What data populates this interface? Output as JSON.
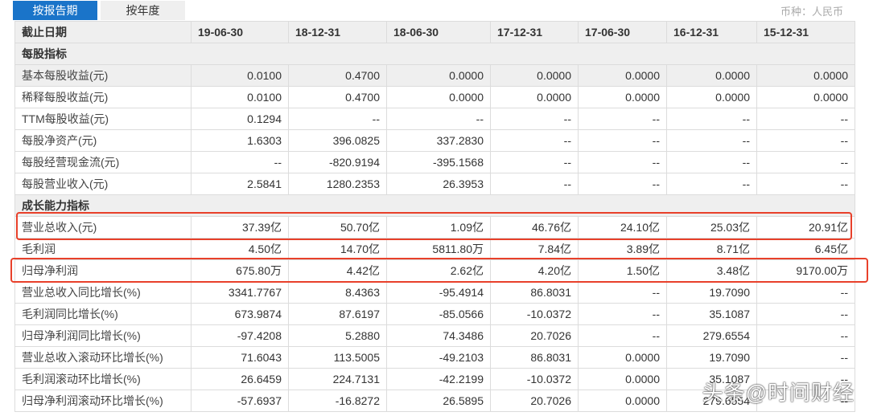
{
  "tabs": [
    "按报告期",
    "按年度"
  ],
  "currency": "币种：人民币",
  "header": [
    "截止日期",
    "19-06-30",
    "18-12-31",
    "18-06-30",
    "17-12-31",
    "17-06-30",
    "16-12-31",
    "15-12-31"
  ],
  "sections": [
    {
      "title": "每股指标",
      "rows": [
        {
          "label": "基本每股收益(元)",
          "values": [
            "0.0100",
            "0.4700",
            "0.0000",
            "0.0000",
            "0.0000",
            "0.0000",
            "0.0000"
          ]
        },
        {
          "label": "稀释每股收益(元)",
          "values": [
            "0.0100",
            "0.4700",
            "0.0000",
            "0.0000",
            "0.0000",
            "0.0000",
            "0.0000"
          ]
        },
        {
          "label": "TTM每股收益(元)",
          "values": [
            "0.1294",
            "--",
            "--",
            "--",
            "--",
            "--",
            "--"
          ]
        },
        {
          "label": "每股净资产(元)",
          "values": [
            "1.6303",
            "396.0825",
            "337.2830",
            "--",
            "--",
            "--",
            "--"
          ]
        },
        {
          "label": "每股经营现金流(元)",
          "values": [
            "--",
            "-820.9194",
            "-395.1568",
            "--",
            "--",
            "--",
            "--"
          ]
        },
        {
          "label": "每股营业收入(元)",
          "values": [
            "2.5841",
            "1280.2353",
            "26.3953",
            "--",
            "--",
            "--",
            "--"
          ]
        }
      ]
    },
    {
      "title": "成长能力指标",
      "rows": [
        {
          "label": "营业总收入(元)",
          "values": [
            "37.39亿",
            "50.70亿",
            "1.09亿",
            "46.76亿",
            "24.10亿",
            "25.03亿",
            "20.91亿"
          ]
        },
        {
          "label": "毛利润",
          "values": [
            "4.50亿",
            "14.70亿",
            "5811.80万",
            "7.84亿",
            "3.89亿",
            "8.71亿",
            "6.45亿"
          ]
        },
        {
          "label": "归母净利润",
          "values": [
            "675.80万",
            "4.42亿",
            "2.62亿",
            "4.20亿",
            "1.50亿",
            "3.48亿",
            "9170.00万"
          ]
        },
        {
          "label": "营业总收入同比增长(%)",
          "values": [
            "3341.7767",
            "8.4363",
            "-95.4914",
            "86.8031",
            "--",
            "19.7090",
            "--"
          ]
        },
        {
          "label": "毛利润同比增长(%)",
          "values": [
            "673.9874",
            "87.6197",
            "-85.0566",
            "-10.0372",
            "--",
            "35.1087",
            "--"
          ]
        },
        {
          "label": "归母净利润同比增长(%)",
          "values": [
            "-97.4208",
            "5.2880",
            "74.3486",
            "20.7026",
            "--",
            "279.6554",
            "--"
          ]
        },
        {
          "label": "营业总收入滚动环比增长(%)",
          "values": [
            "71.6043",
            "113.5005",
            "-49.2103",
            "86.8031",
            "0.0000",
            "19.7090",
            "--"
          ]
        },
        {
          "label": "毛利润滚动环比增长(%)",
          "values": [
            "26.6459",
            "224.7131",
            "-42.2199",
            "-10.0372",
            "0.0000",
            "35.1087",
            "--"
          ]
        },
        {
          "label": "归母净利润滚动环比增长(%)",
          "values": [
            "-57.6937",
            "-16.8272",
            "26.5895",
            "20.7026",
            "0.0000",
            "279.6554",
            "--"
          ]
        }
      ]
    }
  ],
  "watermark": "头条@时间财经",
  "colors": {
    "accent": "#1a74c9",
    "highlight": "#e8402a"
  }
}
